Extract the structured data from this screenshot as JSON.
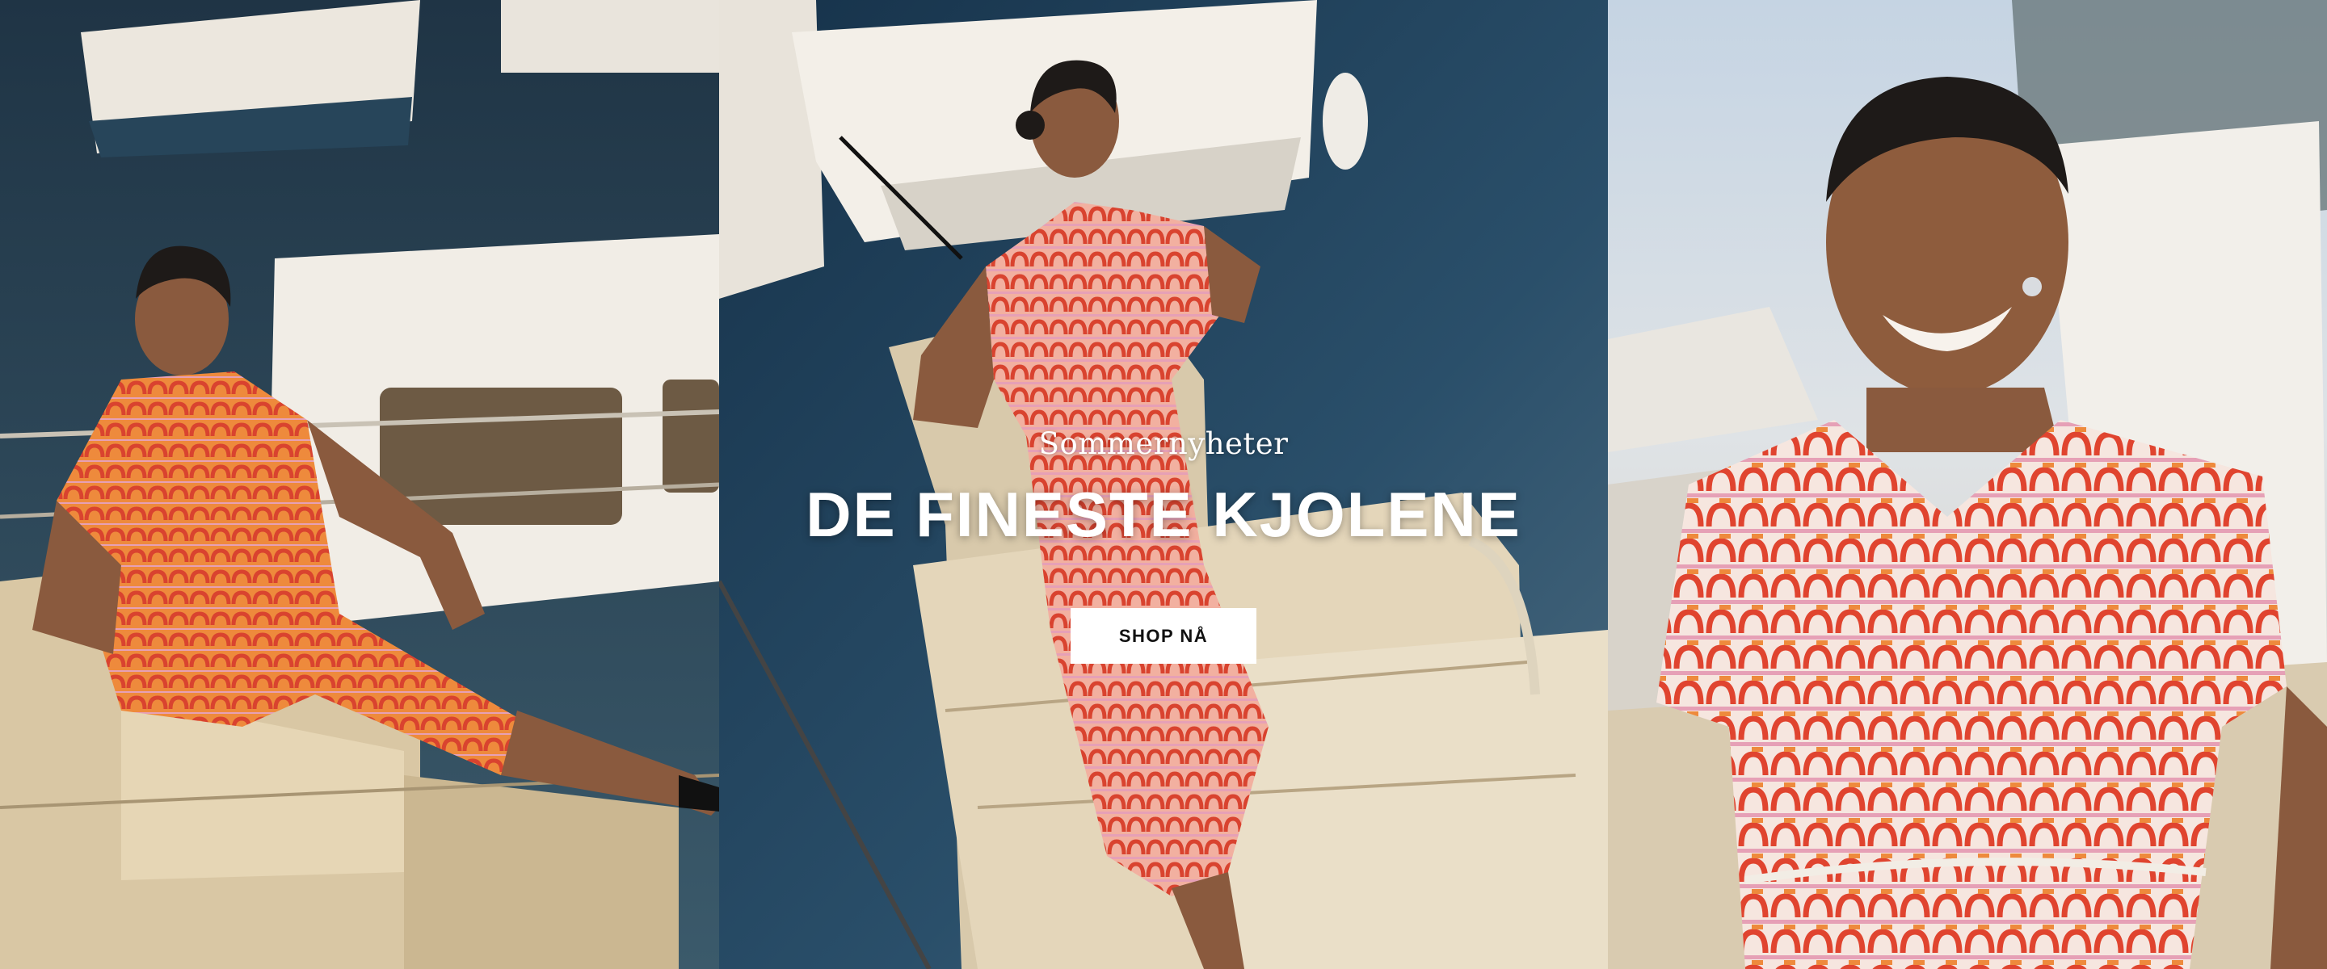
{
  "hero": {
    "kicker": "Sommernyheter",
    "headline": "DE FINESTE KJOLENE",
    "cta_label": "SHOP NÅ"
  },
  "panels": [
    {
      "id": "left",
      "scene": "woman-seated-on-stone-steps-by-harbor-boats"
    },
    {
      "id": "center",
      "scene": "woman-reclining-on-stone-pier-by-water"
    },
    {
      "id": "right",
      "scene": "woman-smiling-closeup-by-boats"
    }
  ],
  "colors": {
    "dress_red": "#d9432f",
    "dress_orange": "#ee8a3c",
    "dress_pink": "#e6a0b6",
    "water": "#2a4a5f",
    "stone": "#d9c7a4",
    "boat": "#f1ede6",
    "cta_bg": "#ffffff",
    "cta_text": "#111111"
  }
}
